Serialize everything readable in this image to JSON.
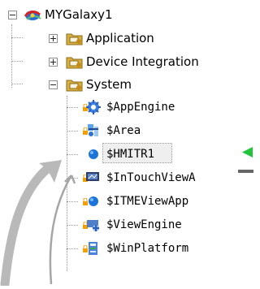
{
  "tree": {
    "root": {
      "label": "MYGalaxy1",
      "icon": "galaxy-icon",
      "expanded": true
    },
    "items": [
      {
        "label": "Application",
        "icon": "folder-icon",
        "expanded": false
      },
      {
        "label": "Device Integration",
        "icon": "folder-icon",
        "expanded": false
      },
      {
        "label": "System",
        "icon": "folder-icon",
        "expanded": true,
        "children": [
          {
            "label": "$AppEngine",
            "icon": "app-engine-icon"
          },
          {
            "label": "$Area",
            "icon": "area-icon"
          },
          {
            "label": "$HMITR1",
            "icon": "blue-sphere-icon",
            "selected": true
          },
          {
            "label": "$InTouchViewA",
            "icon": "intouch-view-icon"
          },
          {
            "label": "$ITMEViewApp",
            "icon": "blue-sphere-icon"
          },
          {
            "label": "$ViewEngine",
            "icon": "view-engine-icon"
          },
          {
            "label": "$WinPlatform",
            "icon": "winplatform-icon"
          }
        ]
      }
    ]
  },
  "colors": {
    "tree_line": "#9a9a9a",
    "selected_bg": "#efefef",
    "green_arrow": "#22c43a",
    "folder_gold": "#caa233",
    "sphere_blue": "#1d74d8"
  }
}
